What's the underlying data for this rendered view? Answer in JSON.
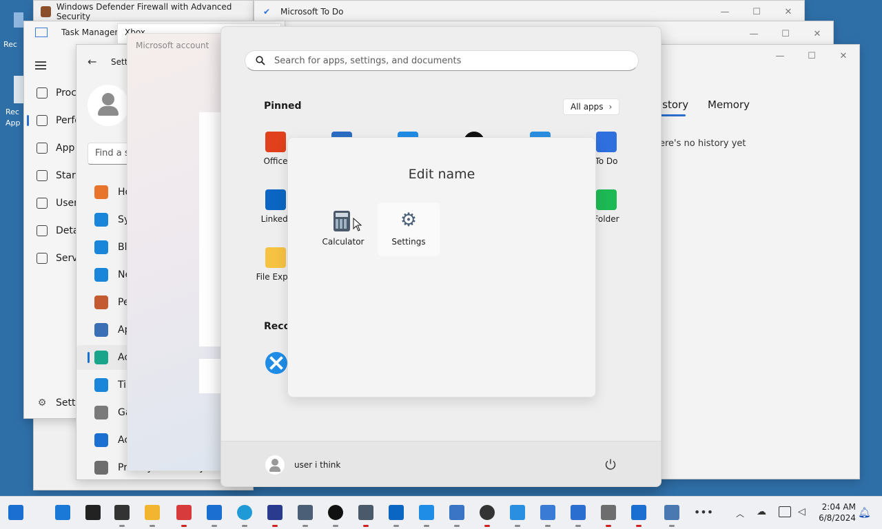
{
  "desktop": {
    "edge_label_1": "Rec",
    "edge_label_2": "Rec",
    "edge_label_3": "App"
  },
  "firewall_window": {
    "title": "Windows Defender Firewall with Advanced Security"
  },
  "todo_window": {
    "title": "Microsoft To Do"
  },
  "taskmanager_window": {
    "title": "Task Manager",
    "nav": [
      {
        "label": "Proc",
        "icon": "processes-icon"
      },
      {
        "label": "Perfo",
        "icon": "performance-icon"
      },
      {
        "label": "App",
        "icon": "app-history-icon"
      },
      {
        "label": "Start",
        "icon": "startup-icon"
      },
      {
        "label": "User",
        "icon": "users-icon"
      },
      {
        "label": "Deta",
        "icon": "details-icon"
      },
      {
        "label": "Serv",
        "icon": "services-icon"
      }
    ],
    "settings_label": "Setti"
  },
  "xbox_window": {
    "title": "Xbox"
  },
  "settings_window": {
    "title": "Setti",
    "search_placeholder": "Find a s",
    "nav": [
      {
        "label": "Ho",
        "icon": "home-icon",
        "color": "#e8732a"
      },
      {
        "label": "Sy",
        "icon": "system-icon",
        "color": "#1a86d9"
      },
      {
        "label": "Blu",
        "icon": "bluetooth-icon",
        "color": "#1a86d9"
      },
      {
        "label": "Ne",
        "icon": "network-icon",
        "color": "#1a86d9"
      },
      {
        "label": "Pe",
        "icon": "personalization-icon",
        "color": "#c45a30"
      },
      {
        "label": "Ap",
        "icon": "apps-icon",
        "color": "#3a6fb5"
      },
      {
        "label": "Ac",
        "icon": "accounts-icon",
        "color": "#19a58a"
      },
      {
        "label": "Tir",
        "icon": "time-language-icon",
        "color": "#1a86d9"
      },
      {
        "label": "Ga",
        "icon": "gaming-icon",
        "color": "#7a7a7a"
      },
      {
        "label": "Ac",
        "icon": "accessibility-icon",
        "color": "#1a6fd1"
      },
      {
        "label": "Privacy & security",
        "icon": "privacy-shield-icon",
        "color": "#6d6d6d"
      }
    ]
  },
  "account_window": {
    "title": "Microsoft account"
  },
  "calculator_window": {
    "tab_history": "istory",
    "tab_memory": "Memory",
    "history_text": "ere's no history yet"
  },
  "start_menu": {
    "search_placeholder": "Search for apps, settings, and documents",
    "pinned_label": "Pinned",
    "all_apps_label": "All apps",
    "pinned": [
      {
        "label": "Office",
        "icon": "office-icon",
        "color": "#e0401c"
      },
      {
        "label": "",
        "icon": "store-icon",
        "color": "#2b6cc4"
      },
      {
        "label": "",
        "icon": "calendar-icon",
        "color": "#1f8ce6"
      },
      {
        "label": "",
        "icon": "xbox-icon",
        "color": "#111111"
      },
      {
        "label": "",
        "icon": "photos-icon",
        "color": "#2a8fe0"
      },
      {
        "label": "To Do",
        "icon": "todo-icon",
        "color": "#2f6fde"
      },
      {
        "label": "LinkedI",
        "icon": "linkedin-icon",
        "color": "#0a66c2"
      },
      {
        "label": "Folder",
        "icon": "spotify-folder-icon",
        "color": "#1db954"
      },
      {
        "label": "File Explo",
        "icon": "file-explorer-icon",
        "color": "#f5c242"
      }
    ],
    "recommended_label": "Reco",
    "folder": {
      "title": "Edit name",
      "apps": [
        {
          "label": "Calculator",
          "icon": "calculator-icon"
        },
        {
          "label": "Settings",
          "icon": "settings-gear-icon"
        }
      ]
    },
    "user_name": "user i think",
    "power_icon": "power-icon"
  },
  "taskbar": {
    "icons": [
      "task-view-icon",
      "start-icon",
      "search-icon",
      "terminal-icon",
      "file-explorer-icon",
      "store-icon",
      "mail-icon",
      "edge-icon",
      "clipchamp-icon",
      "settings-icon",
      "xbox-icon",
      "calculator-icon",
      "outlook-icon",
      "dev-home-icon",
      "notepad-icon",
      "clock-icon",
      "paint-icon",
      "remote-desktop-icon",
      "display-icon",
      "control-panel-icon",
      "defender-icon",
      "task-manager-icon",
      "more-icon"
    ],
    "time": "2:04 AM",
    "date": "6/8/2024"
  }
}
